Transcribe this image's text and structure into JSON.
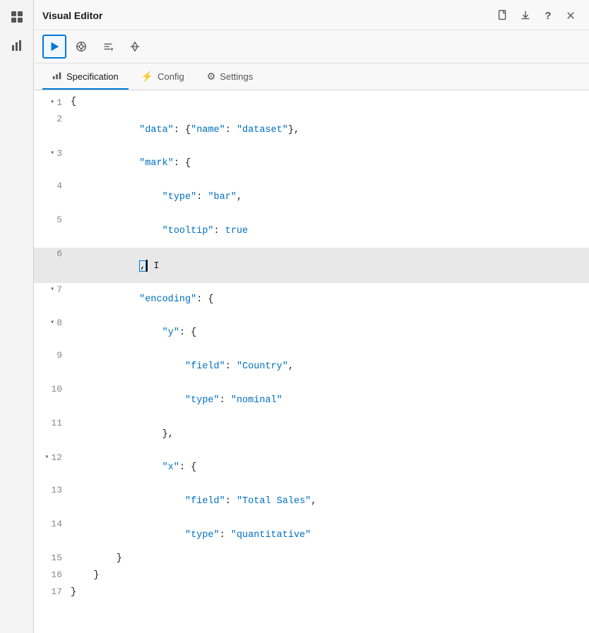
{
  "sidebar": {
    "icons": [
      {
        "name": "grid-icon",
        "symbol": "⊞"
      },
      {
        "name": "chart-icon",
        "symbol": "📊"
      }
    ]
  },
  "panel": {
    "title": "Visual Editor",
    "close_label": "×",
    "header_icons": [
      {
        "name": "new-file-icon",
        "tooltip": "New"
      },
      {
        "name": "export-icon",
        "tooltip": "Export"
      },
      {
        "name": "help-icon",
        "tooltip": "Help",
        "label": "?"
      }
    ]
  },
  "toolbar": {
    "buttons": [
      {
        "name": "run-button",
        "active": true,
        "tooltip": "Run"
      },
      {
        "name": "debug-button",
        "active": false,
        "tooltip": "Debug"
      },
      {
        "name": "format-button",
        "active": false,
        "tooltip": "Format"
      },
      {
        "name": "diff-button",
        "active": false,
        "tooltip": "Diff"
      }
    ]
  },
  "tabs": [
    {
      "name": "specification-tab",
      "label": "Specification",
      "icon": "bar-chart",
      "active": true
    },
    {
      "name": "config-tab",
      "label": "Config",
      "icon": "lightning",
      "active": false
    },
    {
      "name": "settings-tab",
      "label": "Settings",
      "icon": "gear",
      "active": false
    }
  ],
  "code": {
    "lines": [
      {
        "num": "1",
        "fold": true,
        "content": "{",
        "highlighted": false
      },
      {
        "num": "2",
        "fold": false,
        "content": "    \"data\": {\"name\": \"dataset\"},",
        "highlighted": false
      },
      {
        "num": "3",
        "fold": true,
        "content": "    \"mark\": {",
        "highlighted": false
      },
      {
        "num": "4",
        "fold": false,
        "content": "        \"type\": \"bar\",",
        "highlighted": false
      },
      {
        "num": "5",
        "fold": false,
        "content": "        \"tooltip\": true",
        "highlighted": false
      },
      {
        "num": "6",
        "fold": false,
        "content": "    },",
        "highlighted": true,
        "cursor": true
      },
      {
        "num": "7",
        "fold": true,
        "content": "    \"encoding\": {",
        "highlighted": false
      },
      {
        "num": "8",
        "fold": true,
        "content": "        \"y\": {",
        "highlighted": false
      },
      {
        "num": "9",
        "fold": false,
        "content": "            \"field\": \"Country\",",
        "highlighted": false
      },
      {
        "num": "10",
        "fold": false,
        "content": "            \"type\": \"nominal\"",
        "highlighted": false
      },
      {
        "num": "11",
        "fold": false,
        "content": "        },",
        "highlighted": false
      },
      {
        "num": "12",
        "fold": true,
        "content": "        \"x\": {",
        "highlighted": false
      },
      {
        "num": "13",
        "fold": false,
        "content": "            \"field\": \"Total Sales\",",
        "highlighted": false
      },
      {
        "num": "14",
        "fold": false,
        "content": "            \"type\": \"quantitative\"",
        "highlighted": false
      },
      {
        "num": "15",
        "fold": false,
        "content": "        }",
        "highlighted": false
      },
      {
        "num": "16",
        "fold": false,
        "content": "    }",
        "highlighted": false
      },
      {
        "num": "17",
        "fold": false,
        "content": "}",
        "highlighted": false
      }
    ]
  }
}
